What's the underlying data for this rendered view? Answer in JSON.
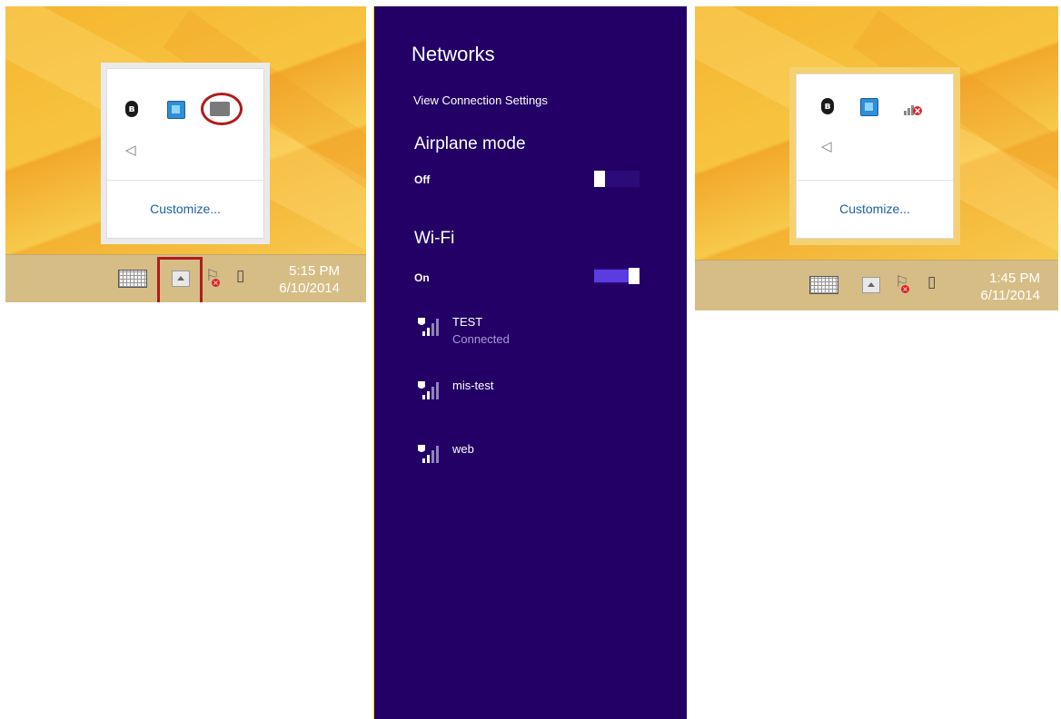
{
  "left_shot": {
    "popup": {
      "icons": [
        "bluetooth-icon",
        "app-tray-icon",
        "network-adapter-icon",
        "speaker-icon"
      ],
      "customize_label": "Customize..."
    },
    "taskbar": {
      "icons": [
        "keyboard-icon",
        "show-hidden-icons-arrow",
        "action-center-flag-icon",
        "battery-icon"
      ],
      "time": "5:15 PM",
      "date": "6/10/2014"
    },
    "highlight_color": "#b01c1c"
  },
  "networks_panel": {
    "title": "Networks",
    "view_settings_link": "View Connection Settings",
    "airplane": {
      "label": "Airplane mode",
      "state": "Off",
      "on": false
    },
    "wifi": {
      "label": "Wi-Fi",
      "state": "On",
      "on": true
    },
    "networks": [
      {
        "name": "TEST",
        "status": "Connected",
        "icon": "secured-wifi-signal-icon"
      },
      {
        "name": "mis-test",
        "status": "",
        "icon": "secured-wifi-signal-icon"
      },
      {
        "name": "web",
        "status": "",
        "icon": "secured-wifi-signal-icon"
      }
    ],
    "background": "#220066",
    "accent": "#5a3ce0"
  },
  "right_shot": {
    "popup": {
      "icons": [
        "bluetooth-icon",
        "app-tray-icon",
        "no-signal-icon",
        "speaker-icon"
      ],
      "customize_label": "Customize..."
    },
    "taskbar": {
      "icons": [
        "keyboard-icon",
        "show-hidden-icons-arrow",
        "action-center-flag-icon",
        "battery-icon"
      ],
      "time": "1:45 PM",
      "date": "6/11/2014"
    },
    "popup_border_color": "#f4d172"
  }
}
